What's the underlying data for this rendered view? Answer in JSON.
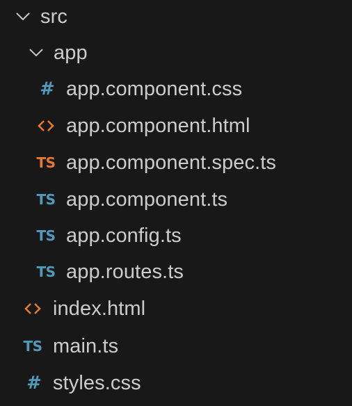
{
  "explorer": {
    "items": [
      {
        "label": "src",
        "kind": "folder",
        "expanded": true,
        "icon": "chevron-down-icon"
      },
      {
        "label": "app",
        "kind": "folder",
        "expanded": true,
        "icon": "chevron-down-icon"
      },
      {
        "label": "app.component.css",
        "kind": "file",
        "icon": "css-hash-icon",
        "icon_text": "#",
        "icon_color": "#519aba"
      },
      {
        "label": "app.component.html",
        "kind": "file",
        "icon": "html-code-icon",
        "icon_color": "#e37933"
      },
      {
        "label": "app.component.spec.ts",
        "kind": "file",
        "icon": "typescript-spec-icon",
        "icon_text": "TS",
        "icon_color": "#e37933"
      },
      {
        "label": "app.component.ts",
        "kind": "file",
        "icon": "typescript-icon",
        "icon_text": "TS",
        "icon_color": "#519aba"
      },
      {
        "label": "app.config.ts",
        "kind": "file",
        "icon": "typescript-icon",
        "icon_text": "TS",
        "icon_color": "#519aba"
      },
      {
        "label": "app.routes.ts",
        "kind": "file",
        "icon": "typescript-icon",
        "icon_text": "TS",
        "icon_color": "#519aba"
      },
      {
        "label": "index.html",
        "kind": "file",
        "icon": "html-code-icon",
        "icon_color": "#e37933"
      },
      {
        "label": "main.ts",
        "kind": "file",
        "icon": "typescript-icon",
        "icon_text": "TS",
        "icon_color": "#519aba"
      },
      {
        "label": "styles.css",
        "kind": "file",
        "icon": "css-hash-icon",
        "icon_text": "#",
        "icon_color": "#519aba"
      }
    ]
  },
  "colors": {
    "background": "#181818",
    "text": "#cccccc",
    "chevron": "#c5c5c5"
  }
}
